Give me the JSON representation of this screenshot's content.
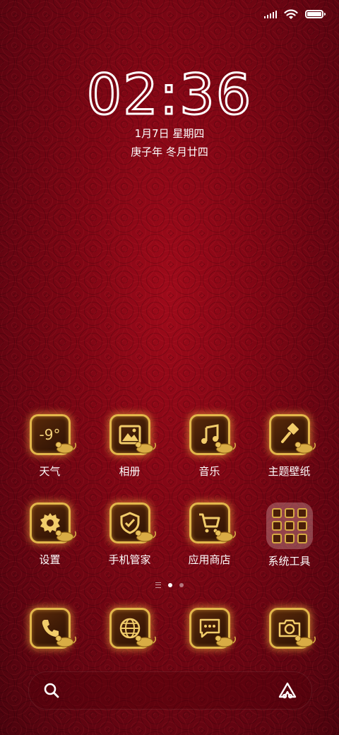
{
  "status": {
    "battery_level": 1.0
  },
  "lockclock": {
    "hour": "02",
    "minute": "36",
    "date": "1月7日 星期四",
    "lunar": "庚子年 冬月廿四"
  },
  "apps_row1": [
    {
      "label": "天气",
      "icon": "weather-icon",
      "temp": "-9°"
    },
    {
      "label": "相册",
      "icon": "gallery-icon"
    },
    {
      "label": "音乐",
      "icon": "music-icon"
    },
    {
      "label": "主题壁纸",
      "icon": "paintbrush-icon"
    }
  ],
  "apps_row2": [
    {
      "label": "设置",
      "icon": "gear-icon"
    },
    {
      "label": "手机管家",
      "icon": "shield-icon"
    },
    {
      "label": "应用商店",
      "icon": "cart-icon"
    },
    {
      "label": "系统工具",
      "icon": "folder-icon"
    }
  ],
  "dock": [
    {
      "name": "phone",
      "icon": "phone-icon"
    },
    {
      "name": "browser",
      "icon": "globe-icon"
    },
    {
      "name": "messages",
      "icon": "message-icon"
    },
    {
      "name": "camera",
      "icon": "camera-icon"
    }
  ],
  "pages": {
    "count": 2,
    "active": 1
  },
  "colors": {
    "gold": "#e3b74b",
    "background": "#7d0614"
  }
}
